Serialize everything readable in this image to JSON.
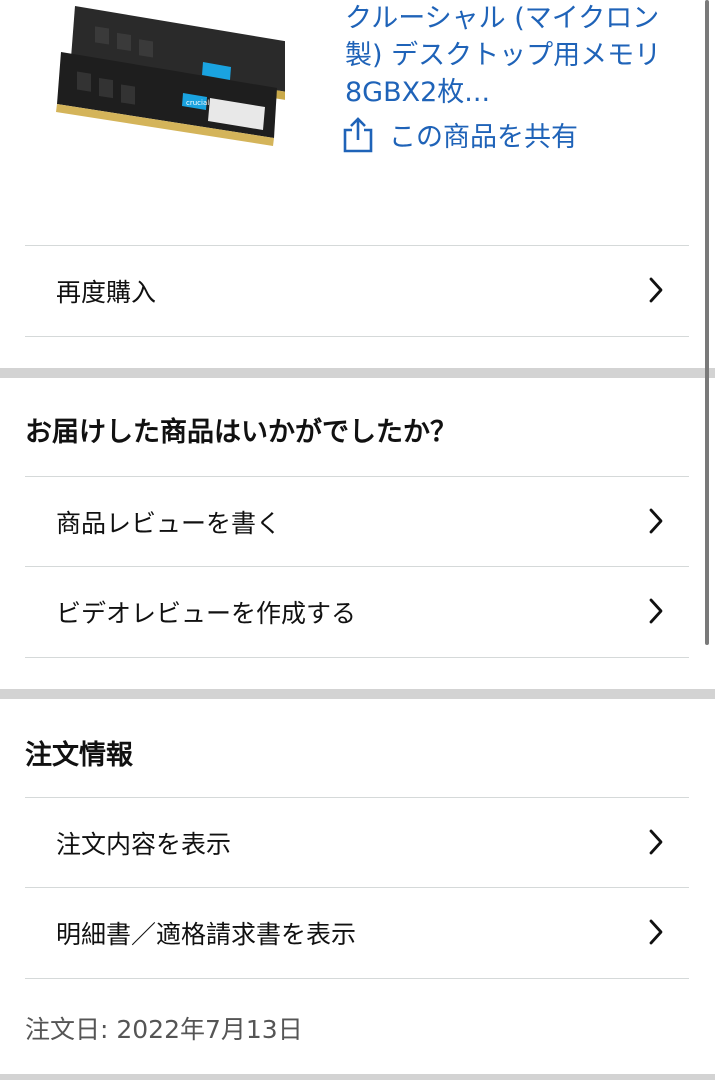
{
  "product": {
    "title": "クルーシャル (マイクロン製) デスクトップ用メモリ 8GBX2枚...",
    "image_label": "crucial",
    "share_label": "この商品を共有"
  },
  "buy_again": {
    "label": "再度購入"
  },
  "review_section": {
    "heading": "お届けした商品はいかがでしたか？",
    "items": [
      {
        "label": "商品レビューを書く"
      },
      {
        "label": "ビデオレビューを作成する"
      }
    ]
  },
  "order_info": {
    "heading": "注文情報",
    "items": [
      {
        "label": "注文内容を表示"
      },
      {
        "label": "明細書／適格請求書を表示"
      }
    ],
    "order_date": "注文日: 2022年7月13日"
  },
  "colors": {
    "link": "#1f63b8",
    "divider": "#d5d9d9",
    "section_gap": "#d3d3d3"
  }
}
